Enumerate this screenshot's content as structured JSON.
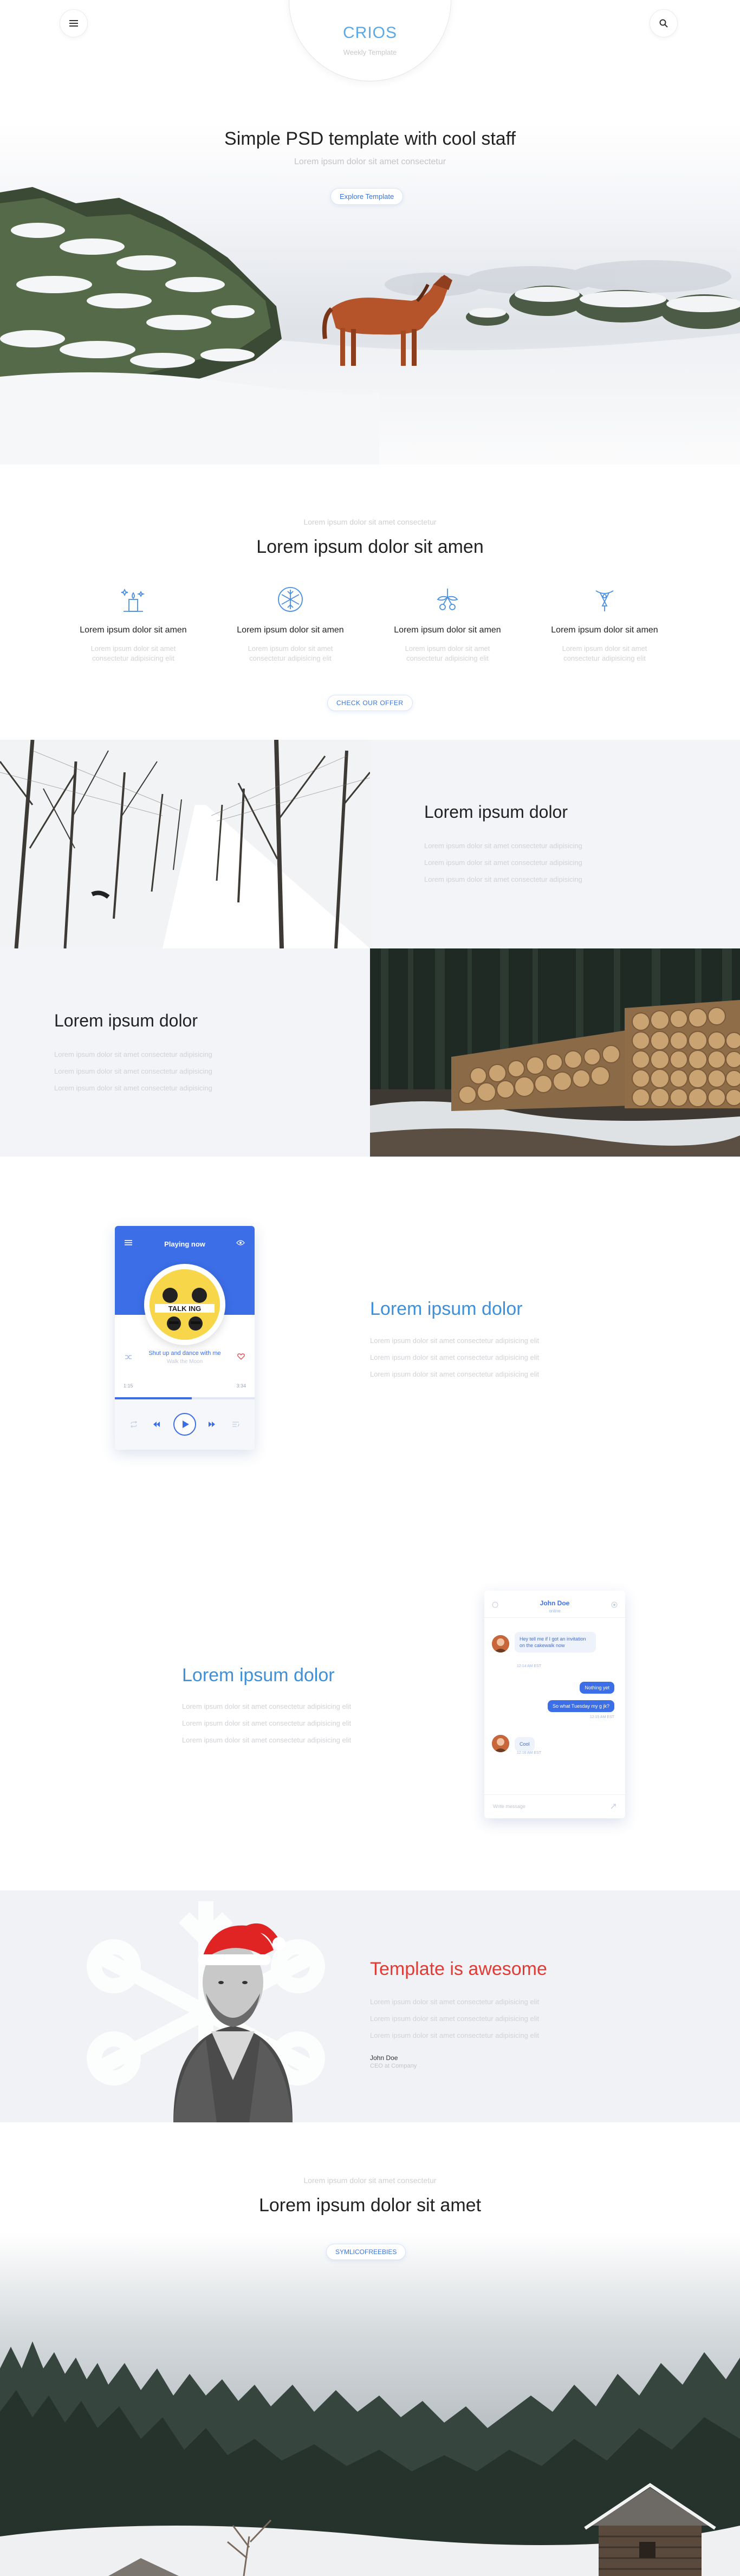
{
  "header": {
    "logo": "CRIOS",
    "logo_tagline": "Weekly Template",
    "menu_icon": "hamburger-icon",
    "search_icon": "search-icon"
  },
  "hero": {
    "title": "Simple PSD template with cool staff",
    "subtitle": "Lorem ipsum dolor sit amet consectetur",
    "button": "Explore Template"
  },
  "features": {
    "kicker": "Lorem ipsum dolor sit amet consectetur",
    "title": "Lorem ipsum dolor sit amen",
    "items": [
      {
        "icon": "candle-stars-icon",
        "title": "Lorem ipsum dolor sit amen",
        "text": "Lorem ipsum dolor sit amet consectetur adipisicing elit"
      },
      {
        "icon": "snowflake-icon",
        "title": "Lorem ipsum dolor sit amen",
        "text": "Lorem ipsum dolor sit amet consectetur adipisicing elit"
      },
      {
        "icon": "mistletoe-icon",
        "title": "Lorem ipsum dolor sit amen",
        "text": "Lorem ipsum dolor sit amet consectetur adipisicing elit"
      },
      {
        "icon": "christmas-lamp-icon",
        "title": "Lorem ipsum dolor sit amen",
        "text": "Lorem ipsum dolor sit amet consectetur adipisicing elit"
      }
    ],
    "button": "CHECK OUR OFFER"
  },
  "split1": {
    "title": "Lorem ipsum dolor",
    "lines": [
      "Lorem ipsum dolor sit amet consectetur adipisicing",
      "Lorem ipsum dolor sit amet consectetur adipisicing",
      "Lorem ipsum dolor sit amet consectetur adipisicing"
    ]
  },
  "split2": {
    "title": "Lorem ipsum dolor",
    "lines": [
      "Lorem ipsum dolor sit amet consectetur adipisicing",
      "Lorem ipsum dolor sit amet consectetur adipisicing",
      "Lorem ipsum dolor sit amet consectetur adipisicing"
    ]
  },
  "player_section": {
    "title": "Lorem ipsum dolor",
    "lines": [
      "Lorem ipsum dolor sit amet consectetur adipisicing elit",
      "Lorem ipsum dolor sit amet consectetur adipisicing elit",
      "Lorem ipsum dolor sit amet consectetur adipisicing elit"
    ],
    "player": {
      "header": "Playing now",
      "track": "Shut up and dance with me",
      "artist": "Walk the Moon",
      "album_text": "TALK ING",
      "time_elapsed": "1:15",
      "time_total": "3:34",
      "progress": 0.55
    }
  },
  "chat_section": {
    "title": "Lorem ipsum dolor",
    "lines": [
      "Lorem ipsum dolor sit amet consectetur adipisicing elit",
      "Lorem ipsum dolor sit amet consectetur adipisicing elit",
      "Lorem ipsum dolor sit amet consectetur adipisicing elit"
    ],
    "chat": {
      "name": "John Doe",
      "status": "online",
      "msg1": "Hey tell me if I got an invitation on the cakewalk now",
      "ts1": "12:14 AM EST",
      "msg2": "Nothing yet",
      "msg3": "So what Tuesday my g jk?",
      "ts3": "12:15 AM EST",
      "msg4": "Cool",
      "ts4": "12:16 AM EST",
      "input_placeholder": "Write message"
    }
  },
  "testimonial": {
    "title": "Template is awesome",
    "lines": [
      "Lorem ipsum dolor sit amet consectetur adipisicing elit",
      "Lorem ipsum dolor sit amet consectetur adipisicing elit",
      "Lorem ipsum dolor sit amet consectetur adipisicing elit"
    ],
    "author": "John Doe",
    "role": "CEO at Company"
  },
  "newsletter": {
    "kicker": "Lorem ipsum dolor sit amet consectetur",
    "title": "Lorem ipsum dolor sit amet",
    "button": "SYMLICOFREEBIES"
  }
}
